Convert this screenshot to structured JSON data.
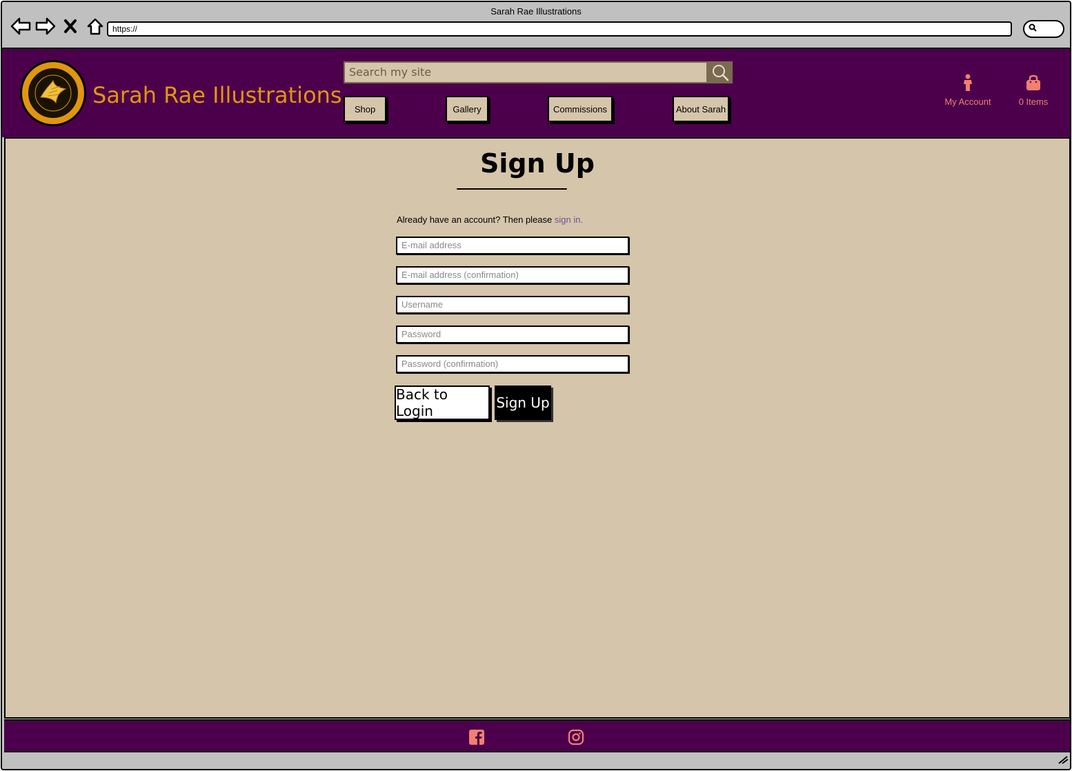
{
  "browser": {
    "window_title": "Sarah Rae Illustrations",
    "url": "https://"
  },
  "header": {
    "site_title": "Sarah Rae Illustrations",
    "search_placeholder": "Search my site",
    "nav": [
      {
        "label": "Shop"
      },
      {
        "label": "Gallery"
      },
      {
        "label": "Commissions"
      },
      {
        "label": "About Sarah"
      }
    ],
    "account_label": "My Account",
    "bag_label": "0 Items"
  },
  "main": {
    "title": "Sign Up",
    "signin_prompt": "Already have an account? Then please",
    "signin_link": "sign in.",
    "fields": [
      {
        "placeholder": "E-mail address"
      },
      {
        "placeholder": "E-mail address (confirmation)"
      },
      {
        "placeholder": "Username"
      },
      {
        "placeholder": "Password"
      },
      {
        "placeholder": "Password (confirmation)"
      }
    ],
    "back_button": "Back to Login",
    "signup_button": "Sign Up"
  },
  "colors": {
    "brand_purple": "#4c004c",
    "accent_gold": "#e0960f",
    "accent_coral": "#f08070",
    "page_bg": "#d5c5aa"
  },
  "icons": {
    "back": "back-arrow-icon",
    "forward": "forward-arrow-icon",
    "close": "close-x-icon",
    "home": "home-icon",
    "search": "search-icon",
    "account": "person-icon",
    "bag": "shopping-bag-icon",
    "facebook": "facebook-icon",
    "instagram": "instagram-icon"
  }
}
